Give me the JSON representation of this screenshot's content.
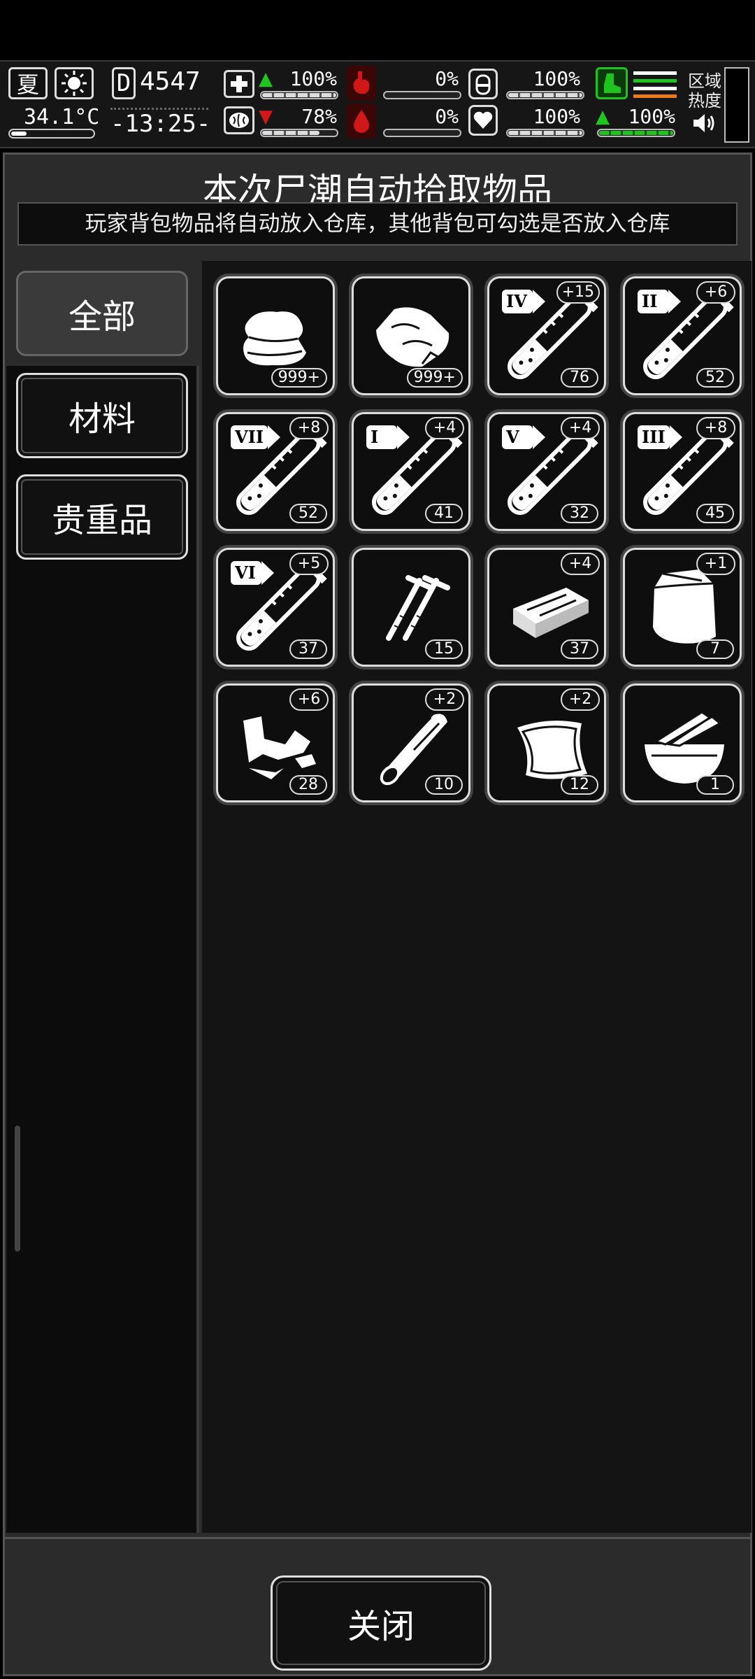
{
  "hud": {
    "season": "夏",
    "temperature": "34.1°C",
    "day_letter": "D",
    "day_number": "4547",
    "clock": "-13:25-",
    "stats": {
      "health": "100%",
      "stomach": "0%",
      "water_bottle": "100%",
      "mind": "78%",
      "blood": "0%",
      "heart": "100%",
      "stamina": "100%"
    },
    "stat_levels": {
      "health": 1.0,
      "stomach": 0.0,
      "water_bottle": 1.0,
      "mind": 0.78,
      "blood": 0.0,
      "heart": 1.0,
      "stamina": 1.0
    },
    "zone_label_1": "区域",
    "zone_label_2": "热度"
  },
  "panel": {
    "title": "本次尸潮自动拾取物品",
    "subtitle": "玩家背包物品将自动放入仓库，其他背包可勾选是否放入仓库"
  },
  "tabs": [
    {
      "label": "全部",
      "active": true
    },
    {
      "label": "材料",
      "active": false
    },
    {
      "label": "贵重品",
      "active": false
    }
  ],
  "items": [
    {
      "icon": "cloth-icon",
      "count": "999+",
      "plus": "",
      "tier": ""
    },
    {
      "icon": "meat-icon",
      "count": "999+",
      "plus": "",
      "tier": ""
    },
    {
      "icon": "test-tube-icon",
      "count": "76",
      "plus": "+15",
      "tier": "IV"
    },
    {
      "icon": "test-tube-icon",
      "count": "52",
      "plus": "+6",
      "tier": "II"
    },
    {
      "icon": "test-tube-icon",
      "count": "52",
      "plus": "+8",
      "tier": "VII"
    },
    {
      "icon": "test-tube-icon",
      "count": "41",
      "plus": "+4",
      "tier": "I"
    },
    {
      "icon": "test-tube-icon",
      "count": "32",
      "plus": "+4",
      "tier": "V"
    },
    {
      "icon": "test-tube-icon",
      "count": "45",
      "plus": "+8",
      "tier": "III"
    },
    {
      "icon": "test-tube-icon",
      "count": "37",
      "plus": "+5",
      "tier": "VI"
    },
    {
      "icon": "nails-icon",
      "count": "15",
      "plus": "",
      "tier": ""
    },
    {
      "icon": "board-icon",
      "count": "37",
      "plus": "+4",
      "tier": ""
    },
    {
      "icon": "plastic-bag-icon",
      "count": "7",
      "plus": "+1",
      "tier": ""
    },
    {
      "icon": "scrap-icon",
      "count": "28",
      "plus": "+6",
      "tier": ""
    },
    {
      "icon": "wood-log-icon",
      "count": "10",
      "plus": "+2",
      "tier": ""
    },
    {
      "icon": "leather-icon",
      "count": "12",
      "plus": "+2",
      "tier": ""
    },
    {
      "icon": "bowl-icon",
      "count": "1",
      "plus": "",
      "tier": ""
    }
  ],
  "close_label": "关闭",
  "colors": {
    "accent_green": "#1fc41f",
    "danger_red": "#d01818",
    "panel": "#2b2b2b"
  }
}
